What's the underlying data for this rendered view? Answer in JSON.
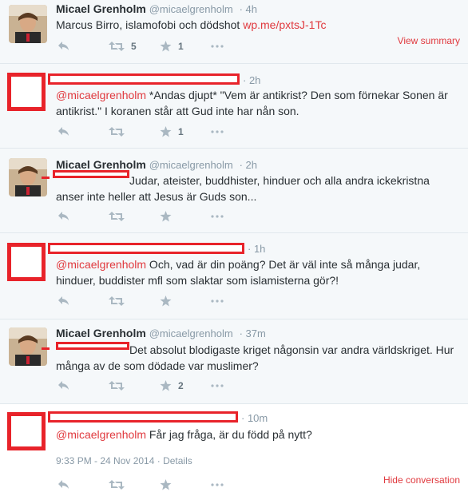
{
  "tweets": [
    {
      "author_name": "Micael Grenholm",
      "author_handle": "@micaelgrenholm",
      "time": "4h",
      "text": "Marcus Birro, islamofobi och dödshot ",
      "link": "wp.me/pxtsJ-1Tc",
      "retweets": "5",
      "favorites": "1",
      "summary_link": "View summary"
    },
    {
      "time": "2h",
      "mention": "@micaelgrenholm",
      "text": " *Andas djupt* \"Vem är antikrist? Den som förnekar Sonen är antikrist.\" I koranen står att Gud inte har nån son.",
      "retweets": "",
      "favorites": "1"
    },
    {
      "author_name": "Micael Grenholm",
      "author_handle": "@micaelgrenholm",
      "time": "2h",
      "text": "Judar, ateister, buddhister, hinduer och alla andra ickekristna anser inte heller att Jesus är Guds son...",
      "retweets": "",
      "favorites": ""
    },
    {
      "time": "1h",
      "mention": "@micaelgrenholm",
      "text": " Och, vad är din poäng? Det är väl inte så många judar, hinduer, buddister mfl som slaktar som islamisterna gör?!",
      "retweets": "",
      "favorites": ""
    },
    {
      "author_name": "Micael Grenholm",
      "author_handle": "@micaelgrenholm",
      "time": "37m",
      "text": " Det absolut blodigaste kriget någonsin var andra världskriget. Hur många av de som dödade var muslimer?",
      "retweets": "",
      "favorites": "2"
    },
    {
      "time": "10m",
      "mention": "@micaelgrenholm",
      "text": " Får jag fråga, är du född på nytt?",
      "timestamp": "9:33 PM - 24 Nov 2014",
      "details": "Details",
      "retweets": "",
      "favorites": "",
      "hide_link": "Hide conversation"
    }
  ],
  "colors": {
    "link": "#e0393e",
    "redaction": "#e8232a",
    "muted": "#8899a6",
    "alt_background": "#f5f8fa"
  },
  "icons": [
    "reply-icon",
    "retweet-icon",
    "favorite-icon",
    "more-icon"
  ]
}
